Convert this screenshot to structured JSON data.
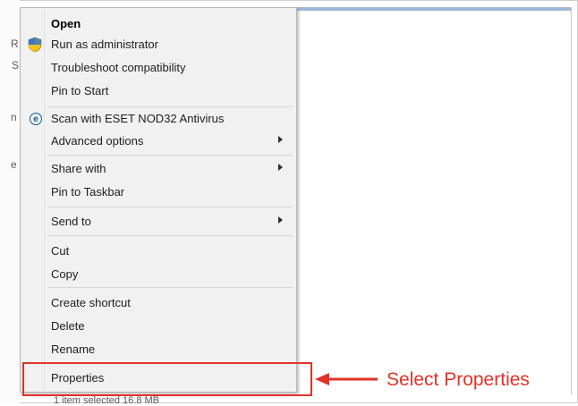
{
  "menu": {
    "items": [
      {
        "label": "Open"
      },
      {
        "label": "Run as administrator",
        "icon": "uac-shield-icon"
      },
      {
        "label": "Troubleshoot compatibility"
      },
      {
        "label": "Pin to Start"
      },
      {
        "label": "Scan with ESET NOD32 Antivirus",
        "icon": "eset-icon",
        "icon_glyph": "e"
      },
      {
        "label": "Advanced options"
      },
      {
        "label": "Share with"
      },
      {
        "label": "Pin to Taskbar"
      },
      {
        "label": "Send to"
      },
      {
        "label": "Cut"
      },
      {
        "label": "Copy"
      },
      {
        "label": "Create shortcut"
      },
      {
        "label": "Delete"
      },
      {
        "label": "Rename"
      },
      {
        "label": "Properties"
      }
    ]
  },
  "annotation": {
    "text": "Select Properties",
    "color": "#e23228"
  },
  "background": {
    "letters": [
      "R",
      "S",
      "n",
      "e"
    ],
    "status_text": "1 item selected  16.8 MB"
  },
  "colors": {
    "menu_bg": "#f1f1f1",
    "window_accent": "#9fb8d9"
  }
}
